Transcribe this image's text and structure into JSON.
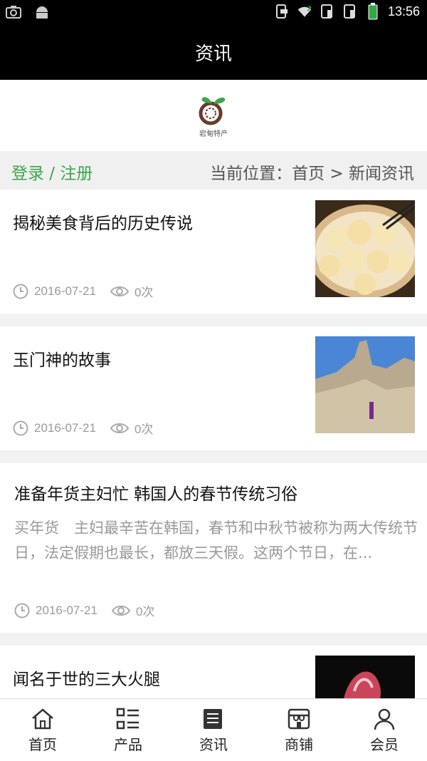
{
  "status": {
    "time": "13:56"
  },
  "header": {
    "title": "资讯"
  },
  "logo": {
    "text": "宕甸特产"
  },
  "crumbs": {
    "login": "登录 / 注册",
    "position": "当前位置：首页 > 新闻资讯"
  },
  "articles": [
    {
      "title": "揭秘美食背后的历史传说",
      "date": "2016-07-21",
      "views": "0次",
      "image": "dumplings-photo"
    },
    {
      "title": "玉门神的故事",
      "date": "2016-07-21",
      "views": "0次",
      "image": "mountain-photo"
    },
    {
      "title": "准备年货主妇忙 韩国人的春节传统习俗",
      "summary": "买年货　主妇最辛苦在韩国，春节和中秋节被称为两大传统节日，法定假期也最长，都放三天假。这两个节日，在...",
      "date": "2016-07-21",
      "views": "0次"
    },
    {
      "title": "闻名于世的三大火腿",
      "image": "ham-photo"
    }
  ],
  "tabs": [
    {
      "label": "首页",
      "icon": "home-icon"
    },
    {
      "label": "产品",
      "icon": "list-icon"
    },
    {
      "label": "资讯",
      "icon": "news-icon"
    },
    {
      "label": "商铺",
      "icon": "shop-icon"
    },
    {
      "label": "会员",
      "icon": "user-icon"
    }
  ]
}
